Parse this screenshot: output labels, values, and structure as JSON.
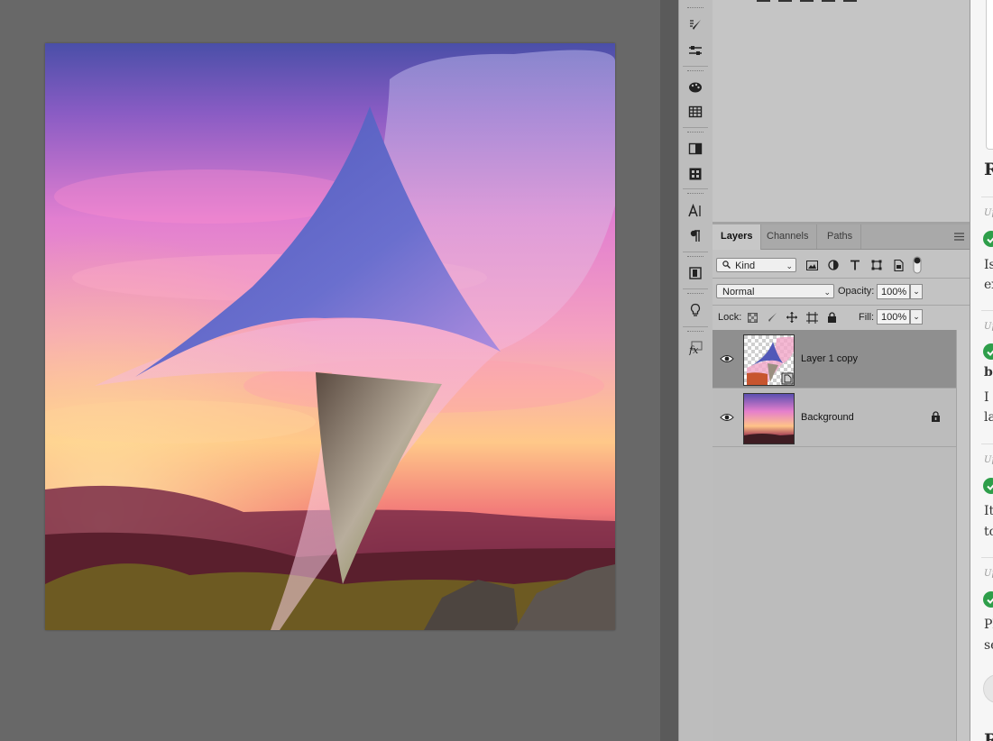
{
  "canvas": {
    "background": "#686868"
  },
  "layers_panel": {
    "tabs": [
      {
        "label": "Layers",
        "active": true
      },
      {
        "label": "Channels",
        "active": false
      },
      {
        "label": "Paths",
        "active": false
      }
    ],
    "filter": {
      "kind_label": "Kind"
    },
    "blend_mode": "Normal",
    "opacity": {
      "label": "Opacity:",
      "value": "100%"
    },
    "lock": {
      "label": "Lock:"
    },
    "fill": {
      "label": "Fill:",
      "value": "100%"
    },
    "layers": [
      {
        "name": "Layer 1 copy",
        "visible": true,
        "selected": true,
        "locked": false
      },
      {
        "name": "Background",
        "visible": true,
        "selected": false,
        "locked": true
      }
    ]
  },
  "right_doc": {
    "heading": "R",
    "entries": [
      {
        "meta": "Up",
        "title": "",
        "body": [
          "Is",
          "ex"
        ]
      },
      {
        "meta": "Up",
        "title": "be",
        "body": [
          "I l",
          "la"
        ]
      },
      {
        "meta": "Up",
        "title": "",
        "body": [
          "It'",
          "to"
        ]
      },
      {
        "meta": "Up",
        "title": "",
        "body": [
          "Pl",
          "se"
        ]
      }
    ],
    "footer": "R",
    "check_color": "#2e9e4a"
  }
}
